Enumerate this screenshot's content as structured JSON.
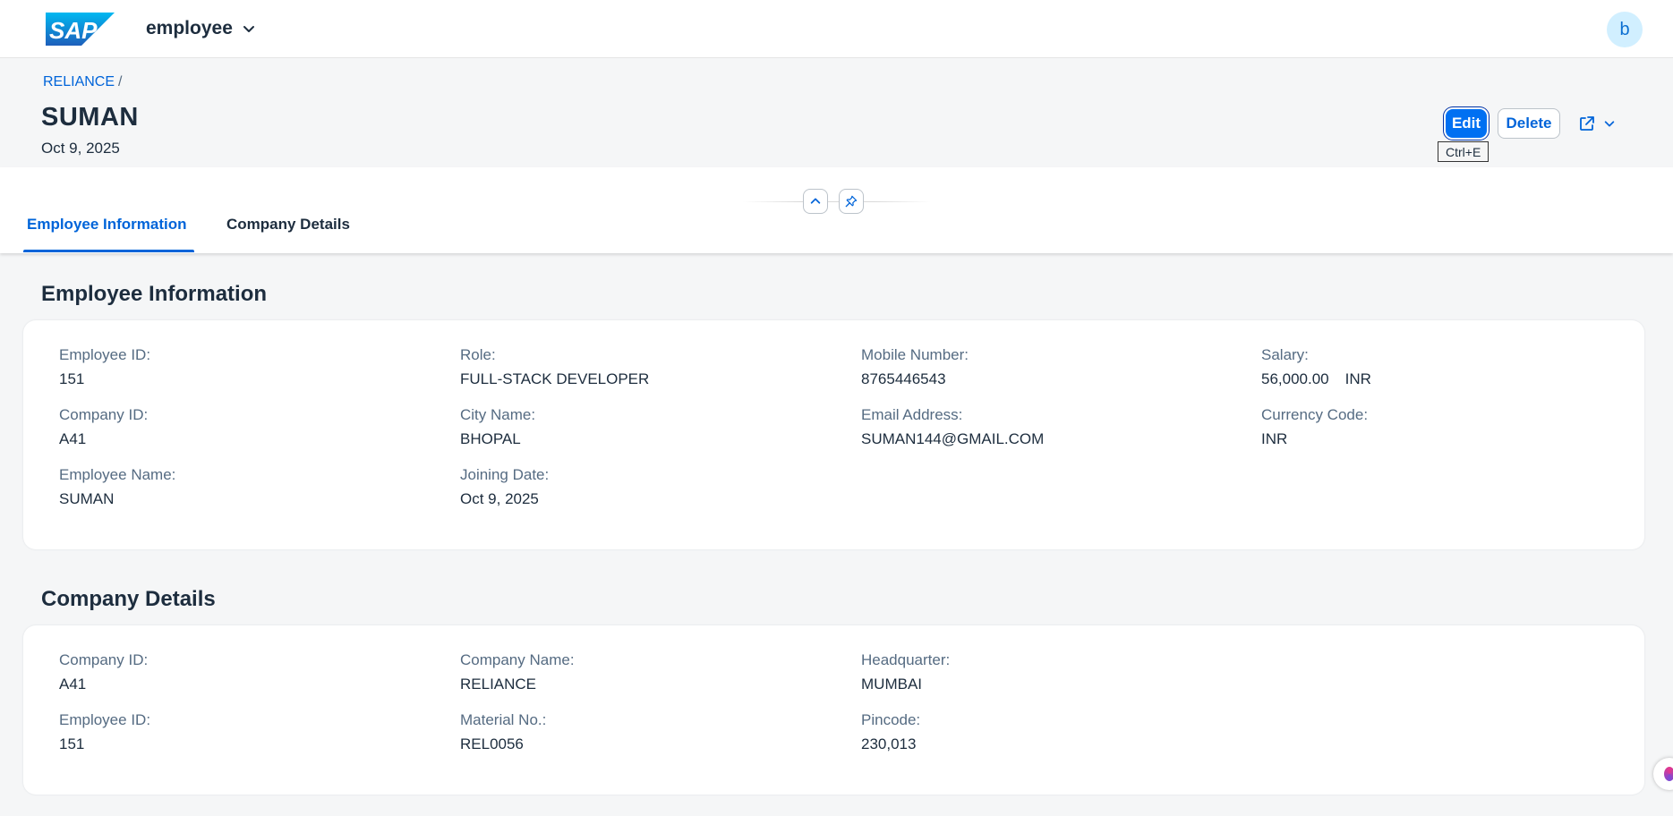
{
  "shellbar": {
    "logo_text": "SAP",
    "app_title": "employee",
    "avatar_initial": "b"
  },
  "header": {
    "breadcrumb": {
      "link": "RELIANCE",
      "separator": "/"
    },
    "title": "SUMAN",
    "subtitle": "Oct 9, 2025",
    "actions": {
      "edit": "Edit",
      "delete": "Delete"
    },
    "tooltip": "Ctrl+E"
  },
  "tabs": [
    {
      "label": "Employee Information",
      "active": true
    },
    {
      "label": "Company Details",
      "active": false
    }
  ],
  "sections": {
    "employee_information": {
      "title": "Employee Information",
      "fields": {
        "employee_id": {
          "label": "Employee ID:",
          "value": "151"
        },
        "company_id": {
          "label": "Company ID:",
          "value": "A41"
        },
        "employee_name": {
          "label": "Employee Name:",
          "value": "SUMAN"
        },
        "role": {
          "label": "Role:",
          "value": "FULL-STACK DEVELOPER"
        },
        "city_name": {
          "label": "City Name:",
          "value": "BHOPAL"
        },
        "joining_date": {
          "label": "Joining Date:",
          "value": "Oct 9, 2025"
        },
        "mobile_number": {
          "label": "Mobile Number:",
          "value": "8765446543"
        },
        "email_address": {
          "label": "Email Address:",
          "value": "SUMAN144@GMAIL.COM"
        },
        "salary": {
          "label": "Salary:",
          "value": "56,000.00",
          "unit": "INR"
        },
        "currency_code": {
          "label": "Currency Code:",
          "value": "INR"
        }
      }
    },
    "company_details": {
      "title": "Company Details",
      "fields": {
        "company_id": {
          "label": "Company ID:",
          "value": "A41"
        },
        "employee_id": {
          "label": "Employee ID:",
          "value": "151"
        },
        "company_name": {
          "label": "Company Name:",
          "value": "RELIANCE"
        },
        "material_no": {
          "label": "Material No.:",
          "value": "REL0056"
        },
        "headquarter": {
          "label": "Headquarter:",
          "value": "MUMBAI"
        },
        "pincode": {
          "label": "Pincode:",
          "value": "230,013"
        }
      }
    }
  },
  "colors": {
    "brand_blue": "#0070f2",
    "link_blue": "#0064d9",
    "text": "#1d2d3e",
    "label_gray": "#556b82",
    "page_bg": "#f5f6f7"
  },
  "icons": {
    "app_title_dropdown": "chevron-down-icon",
    "collapse_header": "chevron-up-icon",
    "pin_header": "pin-icon",
    "share": "share-icon",
    "share_menu": "chevron-down-icon"
  }
}
